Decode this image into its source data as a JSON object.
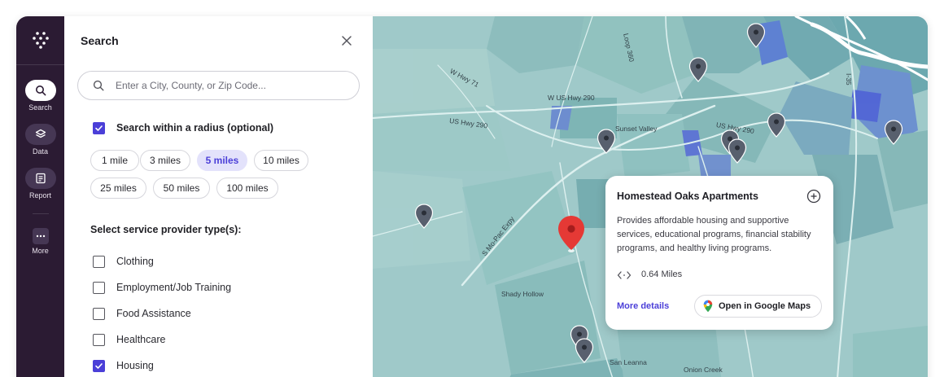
{
  "rail": {
    "items": [
      {
        "label": "Search",
        "icon": "search-icon"
      },
      {
        "label": "Data",
        "icon": "layers-icon"
      },
      {
        "label": "Report",
        "icon": "report-icon"
      },
      {
        "label": "More",
        "icon": "more-icon"
      }
    ]
  },
  "panel": {
    "title": "Search",
    "search_placeholder": "Enter a City, County, or Zip Code...",
    "radius_label": "Search within a radius (optional)",
    "radius_checked": true,
    "radius_options": [
      "1 mile",
      "3 miles",
      "5 miles",
      "10 miles",
      "25 miles",
      "50 miles",
      "100 miles"
    ],
    "radius_selected": "5 miles",
    "provider_title": "Select service provider type(s):",
    "providers": [
      {
        "label": "Clothing",
        "checked": false
      },
      {
        "label": "Employment/Job Training",
        "checked": false
      },
      {
        "label": "Food Assistance",
        "checked": false
      },
      {
        "label": "Healthcare",
        "checked": false
      },
      {
        "label": "Housing",
        "checked": true
      }
    ]
  },
  "map": {
    "labels": {
      "loop": "Loop 360",
      "hwy71": "W Hwy 71",
      "us290_w": "US Hwy 290",
      "w_us290": "W US Hwy 290",
      "us290_e": "US Hwy 290",
      "sunset": "Sunset Valley",
      "i35": "I-35",
      "mopac": "S Mo-Pac Expy",
      "shady": "Shady Hollow",
      "sanleanna": "San Leanna",
      "onion": "Onion Creek"
    },
    "colors": {
      "base": "#9fc9c9",
      "accent": "#4b3fd8",
      "pin": "#58606e",
      "selected_pin": "#e53935"
    }
  },
  "card": {
    "title": "Homestead Oaks Apartments",
    "description": "Provides affordable housing and supportive services, educational programs, financial stability programs, and healthy living programs.",
    "distance": "0.64 Miles",
    "more_details": "More details",
    "open_maps": "Open in Google Maps"
  }
}
